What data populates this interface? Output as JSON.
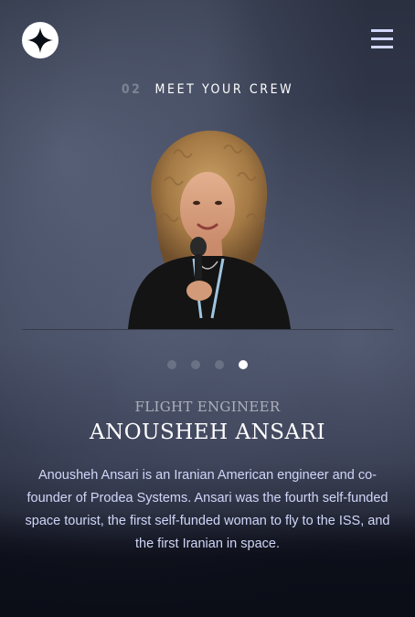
{
  "header": {
    "logo_icon": "star-icon",
    "menu_icon": "hamburger-icon"
  },
  "page": {
    "number": "02",
    "title": "Meet your crew"
  },
  "crew": {
    "image_alt": "Anousheh Ansari",
    "role": "Flight Engineer",
    "name": "Anousheh Ansari",
    "bio": "Anousheh Ansari is an Iranian American engineer and co-founder of Prodea Systems. Ansari was the fourth self-funded space tourist, the first self-funded woman to fly to the ISS, and the first Iranian in space."
  },
  "pagination": {
    "count": 4,
    "active_index": 3
  },
  "colors": {
    "background": "#0b0d17",
    "accent_light": "#d0d6f9",
    "text": "#ffffff"
  }
}
